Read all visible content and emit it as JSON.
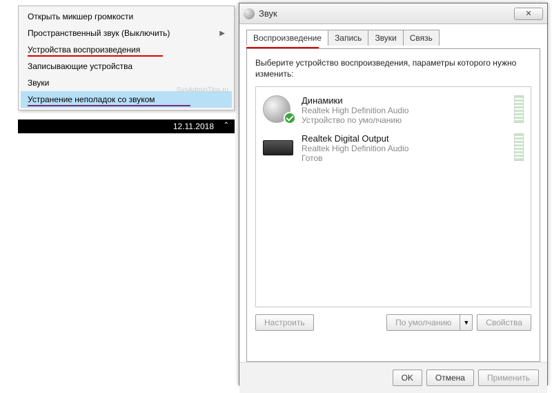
{
  "context_menu": {
    "items": [
      {
        "label": "Открыть микшер громкости",
        "has_arrow": false
      },
      {
        "label": "Пространственный звук (Выключить)",
        "has_arrow": true
      },
      {
        "label": "Устройства воспроизведения",
        "underline": "red"
      },
      {
        "label": "Записывающие устройства"
      },
      {
        "label": "Звуки"
      },
      {
        "label": "Устранение неполадок со звуком",
        "selected": true,
        "underline": "purple"
      }
    ],
    "watermark": "SysAdminTips.ru"
  },
  "taskbar": {
    "date": "12.11.2018"
  },
  "sound_dialog": {
    "title": "Звук",
    "tabs": [
      "Воспроизведение",
      "Запись",
      "Звуки",
      "Связь"
    ],
    "active_tab": 0,
    "instruction": "Выберите устройство воспроизведения, параметры которого нужно изменить:",
    "devices": [
      {
        "name": "Динамики",
        "driver": "Realtek High Definition Audio",
        "status": "Устройство по умолчанию",
        "icon": "speaker",
        "default": true
      },
      {
        "name": "Realtek Digital Output",
        "driver": "Realtek High Definition Audio",
        "status": "Готов",
        "icon": "digital"
      }
    ],
    "buttons": {
      "configure": "Настроить",
      "set_default": "По умолчанию",
      "properties": "Свойства"
    },
    "dialog_buttons": {
      "ok": "OK",
      "cancel": "Отмена",
      "apply": "Применить"
    }
  }
}
